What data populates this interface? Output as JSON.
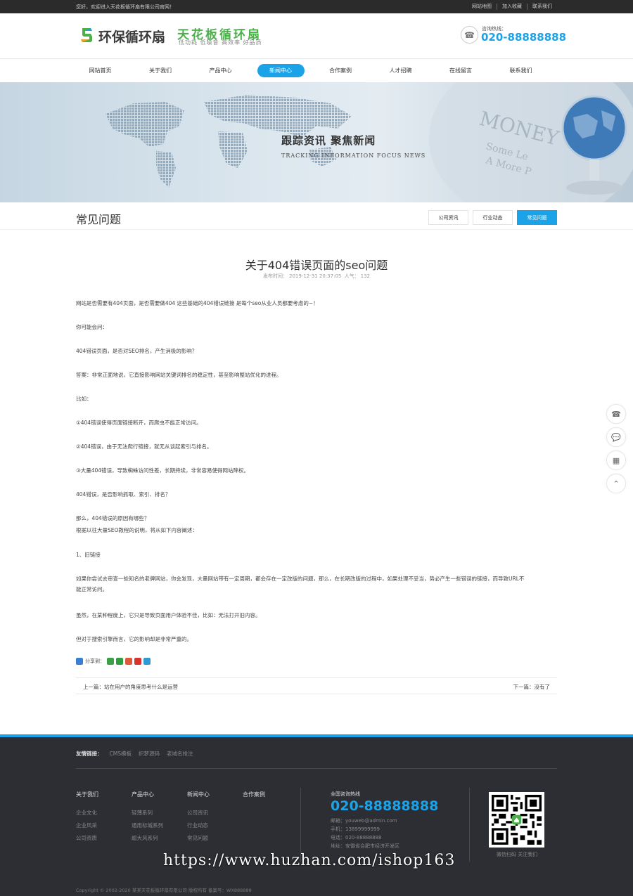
{
  "topbar": {
    "welcome": "您好，欢迎进入天花板循环扇有限公司官网！",
    "links": [
      "网站地图",
      "加入收藏",
      "联系我们"
    ]
  },
  "header": {
    "logo_text": "环保循环扇",
    "slogan_main": "天花板循环扇",
    "slogan_sub": "低功耗 低噪音 高效率 好品质",
    "hotline_label": "咨询热线：",
    "hotline_number": "020-88888888"
  },
  "nav": {
    "items": [
      "网站首页",
      "关于我们",
      "产品中心",
      "新闻中心",
      "合作案例",
      "人才招聘",
      "在线留言",
      "联系我们"
    ],
    "active_index": 3
  },
  "banner": {
    "title": "跟踪资讯  聚焦新闻",
    "subtitle": "TRACKING INFORMATION FOCUS NEWS"
  },
  "section": {
    "title": "常见问题",
    "tabs": [
      "公司资讯",
      "行业动态",
      "常见问题"
    ],
    "active_tab": 2
  },
  "article": {
    "title": "关于404错误页面的seo问题",
    "meta_time_label": "发布时间：",
    "meta_time": "2019-12-31 20:37:05",
    "meta_views_label": "人气：",
    "meta_views": "132",
    "paragraphs": [
      "网站是否需要有404页面，是否需要做404 这些基础的404错误链接 是每个seo从业人员都要考虑的~！",
      "你可能会问：",
      "404错误页面，是否对SEO排名，产生消极的影响？",
      "答案：非常正面地说，它直接影响网站关键词排名的稳定性，甚至影响整站优化的进程。",
      "比如：",
      "①404错误使得页面链接断开，而爬虫不能正常访问。",
      "②404错误，由于无法爬行链接，就无从谈起索引与排名。",
      "③大量404错误，导致蜘蛛访问性差，长期持续，非常容易使得网站降权。",
      "404错误，是否影响抓取、索引、排名？",
      "那么，404错误的原因有哪些？",
      "根据以往大量SEO教程的说明，将从如下内容阐述：",
      "1、旧链接",
      "如果你尝试去审查一些知名的老牌网站，你会发现，大量网站带有一定周期，都会存在一定改版的问题，那么，在长期改版的过程中，如果处理不妥当，势必产生一些错误的链接，而导致URL不",
      "能正常访问。",
      "虽然，在某种程度上，它只是导致页面用户体验不佳，比如：无法打开旧内容。",
      "但对于搜索引擎而言，它的影响却是非常严重的。"
    ],
    "share_label": "分享到："
  },
  "prevnext": {
    "prev_label": "上一篇：",
    "prev_title": "站在用户的角度思考什么是运营",
    "next_label": "下一篇：",
    "next_title": "没有了"
  },
  "float_icons": [
    "phone-icon",
    "chat-icon",
    "qrcode-icon",
    "back-to-top-icon"
  ],
  "footer": {
    "friend_links_label": "友情链接：",
    "friend_links": [
      "CMS模板",
      "织梦源码",
      "老域名抢注"
    ],
    "columns": [
      {
        "heading": "关于我们",
        "items": [
          "企业文化",
          "企业风采",
          "公司资质"
        ]
      },
      {
        "heading": "产品中心",
        "items": [
          "轻薄系列",
          "通用标城系列",
          "超大风系列"
        ]
      },
      {
        "heading": "新闻中心",
        "items": [
          "公司资讯",
          "行业动态",
          "常见问题"
        ]
      },
      {
        "heading": "合作案例",
        "items": []
      }
    ],
    "hotline_label": "全国咨询热线",
    "hotline_number": "020-88888888",
    "email": "邮箱：youweb@admin.com",
    "mobile": "手机：13899999999",
    "tel": "电话：020-88888888",
    "address": "地址：安徽省合肥市经济开发区",
    "qr_caption": "微信扫码 关注我们",
    "copyright": "Copyright © 2002-2020 某某天花板循环扇有限公司 版权所有   备案号：WX888888"
  },
  "watermark": "https://www.huzhan.com/ishop163",
  "colors": {
    "accent": "#1aa3e8",
    "logo_green": "#4bb04a",
    "footer_bg": "#2c2e33"
  }
}
